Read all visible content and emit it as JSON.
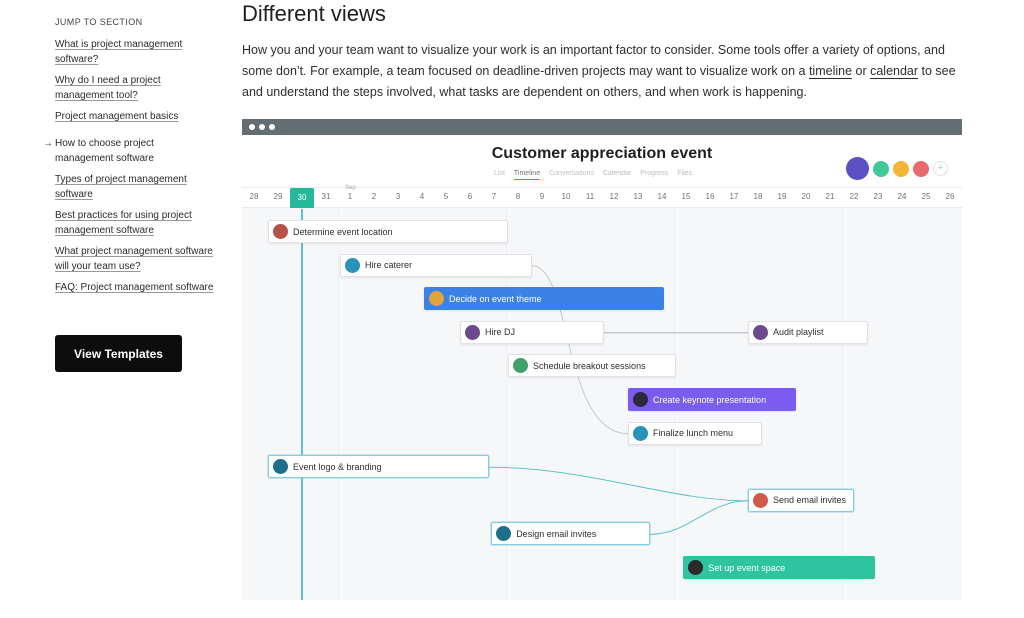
{
  "sidebar": {
    "jump_label": "JUMP TO SECTION",
    "items": [
      {
        "label": "What is project management software?",
        "active": false
      },
      {
        "label": "Why do I need a project management tool?",
        "active": false
      },
      {
        "label": "Project management basics",
        "active": false
      },
      {
        "label": "How to choose project management software",
        "active": true
      },
      {
        "label": "Types of project management software",
        "active": false
      },
      {
        "label": "Best practices for using project management software",
        "active": false
      },
      {
        "label": "What project management software will your team use?",
        "active": false
      },
      {
        "label": "FAQ: Project management software",
        "active": false
      }
    ],
    "active_arrow": "→",
    "cta_label": "View Templates"
  },
  "article": {
    "heading": "Different views",
    "para_part1": "How you and your team want to visualize your work is an important factor to consider. Some tools offer a variety of options, and some don’t. For example, a team focused on deadline-driven projects may want to visualize work on a ",
    "link_timeline": "timeline",
    "para_part2": " or ",
    "link_calendar": "calendar",
    "para_part3": " to see and understand the steps involved, what tasks are dependent on others, and when work is happening."
  },
  "app": {
    "project_title": "Customer appreciation event",
    "tabs": [
      {
        "label": "List",
        "active": false
      },
      {
        "label": "Timeline",
        "active": true
      },
      {
        "label": "Conversations",
        "active": false
      },
      {
        "label": "Calendar",
        "active": false
      },
      {
        "label": "Progress",
        "active": false
      },
      {
        "label": "Files",
        "active": false
      }
    ],
    "members": [
      {
        "color": "#5b4fc4"
      },
      {
        "color": "#3fc99a"
      },
      {
        "color": "#f2b632"
      },
      {
        "color": "#e86a6a"
      }
    ],
    "add_member": "+",
    "month_label": "Sep",
    "dates": [
      "28",
      "29",
      "30",
      "31",
      "1",
      "2",
      "3",
      "4",
      "5",
      "6",
      "7",
      "8",
      "9",
      "10",
      "11",
      "12",
      "13",
      "14",
      "15",
      "16",
      "17",
      "18",
      "19",
      "20",
      "21",
      "22",
      "23",
      "24",
      "25",
      "26"
    ],
    "today_index": 2,
    "tasks": [
      {
        "label": "Determine event location",
        "style": "white",
        "avatar": "#b5524a",
        "start": 1,
        "span": 10,
        "row": 0
      },
      {
        "label": "Hire caterer",
        "style": "white",
        "avatar": "#2a93b8",
        "start": 4,
        "span": 8,
        "row": 1
      },
      {
        "label": "Decide on event theme",
        "style": "blue",
        "avatar": "#e0a43a",
        "start": 7.5,
        "span": 10,
        "row": 2
      },
      {
        "label": "Hire DJ",
        "style": "white",
        "avatar": "#6a4a8c",
        "start": 9,
        "span": 6,
        "row": 3
      },
      {
        "label": "Audit playlist",
        "style": "white",
        "avatar": "#6a4a8c",
        "start": 21,
        "span": 5,
        "row": 3
      },
      {
        "label": "Schedule breakout sessions",
        "style": "white",
        "avatar": "#3fa06a",
        "start": 11,
        "span": 7,
        "row": 4
      },
      {
        "label": "Create keynote presentation",
        "style": "purple",
        "avatar": "#2a2a3a",
        "start": 16,
        "span": 7,
        "row": 5
      },
      {
        "label": "Finalize lunch menu",
        "style": "white",
        "avatar": "#2a93b8",
        "start": 16,
        "span": 5.6,
        "row": 6
      },
      {
        "label": "Event logo & branding",
        "style": "selected",
        "avatar": "#1e6f8c",
        "start": 1,
        "span": 9.2,
        "row": 7
      },
      {
        "label": "Send email invites",
        "style": "selected",
        "avatar": "#d2584a",
        "start": 21,
        "span": 4.4,
        "row": 8
      },
      {
        "label": "Design email invites",
        "style": "selected",
        "avatar": "#1e6f8c",
        "start": 10.3,
        "span": 6.6,
        "row": 9
      },
      {
        "label": "Set up event space",
        "style": "teal",
        "avatar": "#2a2a2a",
        "start": 18.3,
        "span": 8,
        "row": 10
      }
    ]
  }
}
